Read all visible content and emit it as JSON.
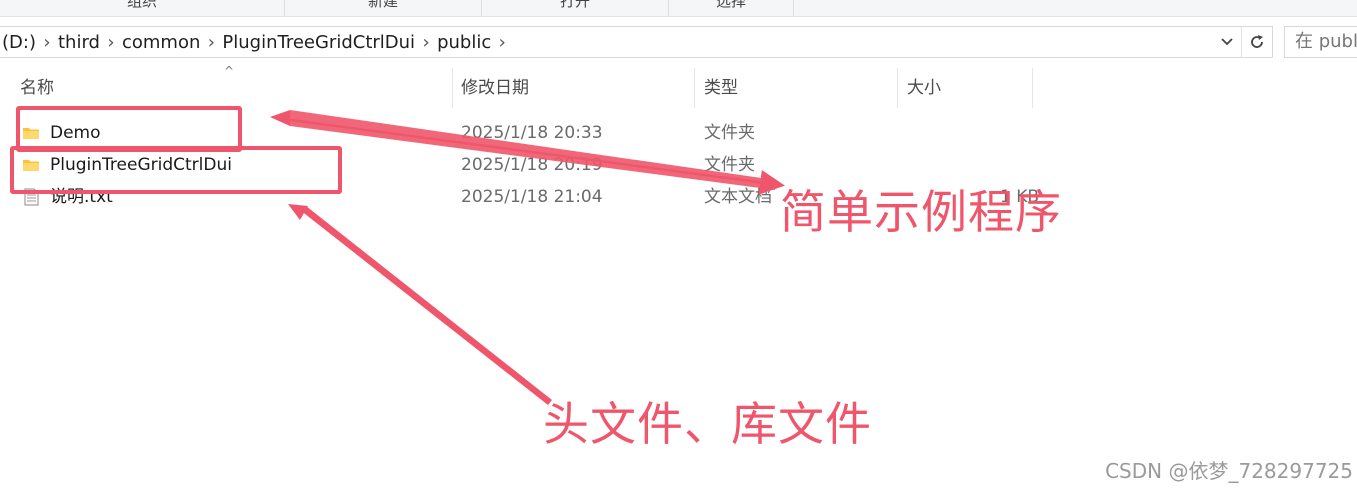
{
  "ribbon": {
    "groups": [
      "组织",
      "新建",
      "打开",
      "选择"
    ]
  },
  "address_bar": {
    "crumbs": [
      "(D:)",
      "third",
      "common",
      "PluginTreeGridCtrlDui",
      "public"
    ],
    "search_placeholder": "在 publ"
  },
  "columns": {
    "name": "名称",
    "date": "修改日期",
    "type": "类型",
    "size": "大小"
  },
  "files": [
    {
      "name": "Demo",
      "date": "2025/1/18 20:33",
      "type": "文件夹",
      "size": "",
      "icon": "folder-icon"
    },
    {
      "name": "PluginTreeGridCtrlDui",
      "date": "2025/1/18 20:19",
      "type": "文件夹",
      "size": "",
      "icon": "folder-icon"
    },
    {
      "name": "说明.txt",
      "date": "2025/1/18 21:04",
      "type": "文本文档",
      "size": "1 KB",
      "icon": "text-file-icon"
    }
  ],
  "annotations": {
    "demo_label": "简单示例程序",
    "lib_label": "头文件、库文件"
  },
  "watermark": "CSDN @依梦_728297725",
  "colors": {
    "annotation": "#f0566b",
    "folder": "#f6c344"
  }
}
